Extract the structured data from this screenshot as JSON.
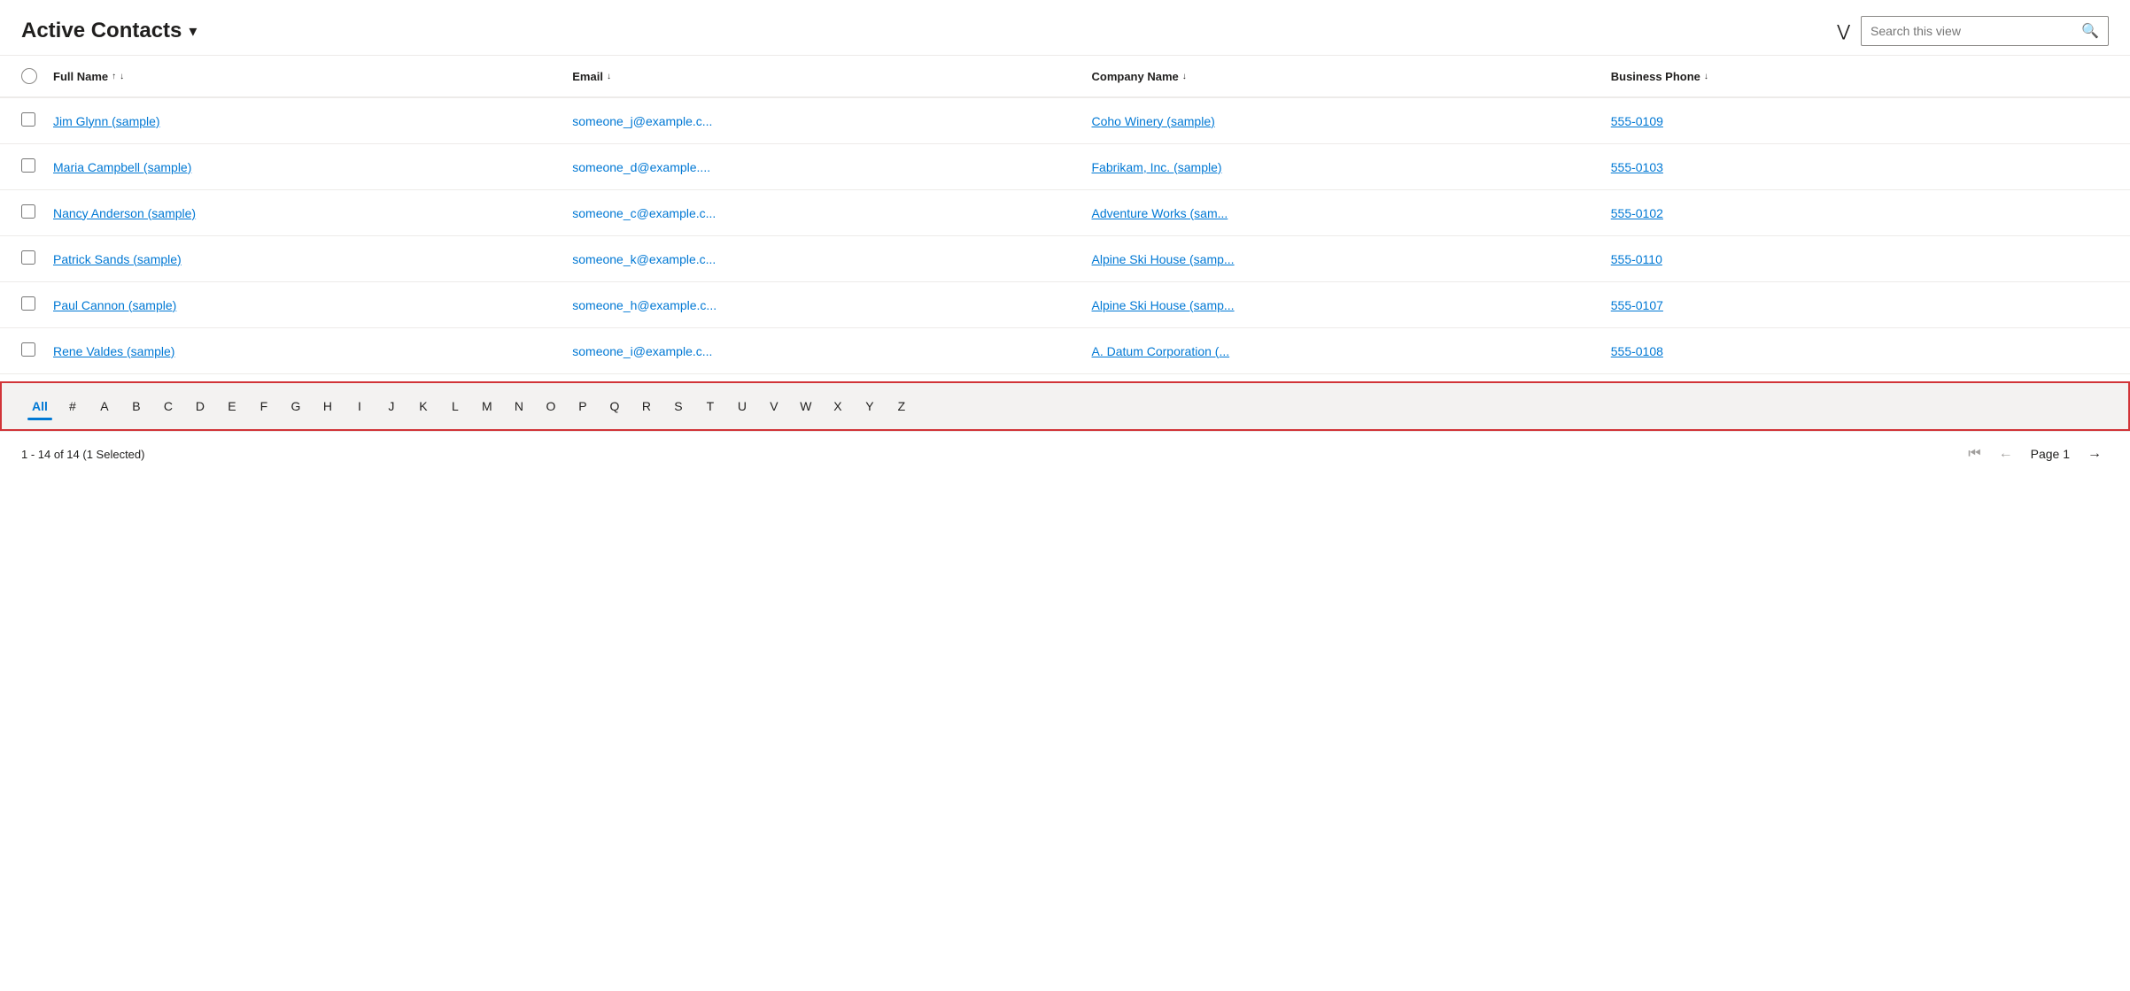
{
  "header": {
    "title": "Active Contacts",
    "chevron": "▾",
    "search_placeholder": "Search this view"
  },
  "columns": [
    {
      "id": "full_name",
      "label": "Full Name",
      "sortable": true,
      "sort_asc": true
    },
    {
      "id": "email",
      "label": "Email",
      "sortable": true
    },
    {
      "id": "company_name",
      "label": "Company Name",
      "sortable": true
    },
    {
      "id": "business_phone",
      "label": "Business Phone",
      "sortable": true
    }
  ],
  "rows": [
    {
      "full_name": "Jim Glynn (sample)",
      "email": "someone_j@example.c...",
      "company_name": "Coho Winery (sample)",
      "business_phone": "555-0109"
    },
    {
      "full_name": "Maria Campbell (sample)",
      "email": "someone_d@example....",
      "company_name": "Fabrikam, Inc. (sample)",
      "business_phone": "555-0103"
    },
    {
      "full_name": "Nancy Anderson (sample)",
      "email": "someone_c@example.c...",
      "company_name": "Adventure Works (sam...",
      "business_phone": "555-0102"
    },
    {
      "full_name": "Patrick Sands (sample)",
      "email": "someone_k@example.c...",
      "company_name": "Alpine Ski House (samp...",
      "business_phone": "555-0110"
    },
    {
      "full_name": "Paul Cannon (sample)",
      "email": "someone_h@example.c...",
      "company_name": "Alpine Ski House (samp...",
      "business_phone": "555-0107"
    },
    {
      "full_name": "Rene Valdes (sample)",
      "email": "someone_i@example.c...",
      "company_name": "A. Datum Corporation (...",
      "business_phone": "555-0108"
    }
  ],
  "alpha_bar": {
    "items": [
      "All",
      "#",
      "A",
      "B",
      "C",
      "D",
      "E",
      "F",
      "G",
      "H",
      "I",
      "J",
      "K",
      "L",
      "M",
      "N",
      "O",
      "P",
      "Q",
      "R",
      "S",
      "T",
      "U",
      "V",
      "W",
      "X",
      "Y",
      "Z"
    ],
    "active": "All"
  },
  "footer": {
    "count_label": "1 - 14 of 14 (1 Selected)",
    "page_label": "Page 1"
  }
}
